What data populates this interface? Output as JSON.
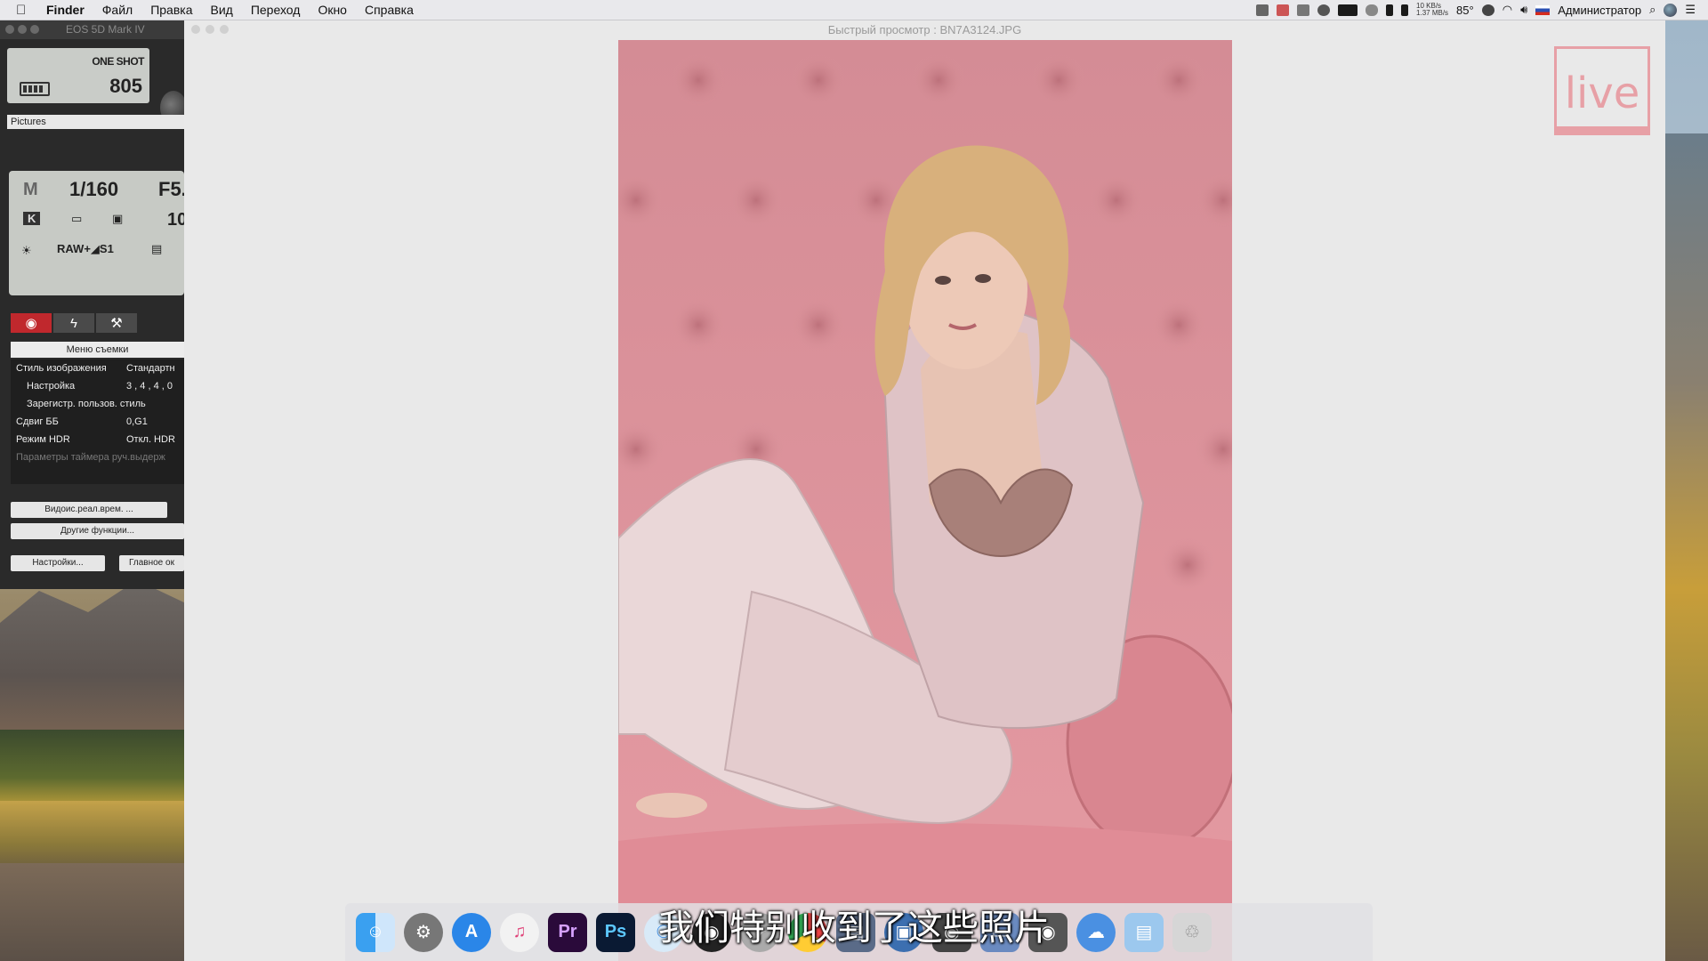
{
  "menubar": {
    "app_name": "Finder",
    "items": [
      "Файл",
      "Правка",
      "Вид",
      "Переход",
      "Окно",
      "Справка"
    ],
    "net_up": "10 KB/s",
    "net_down": "1.37 MB/s",
    "temperature": "85°",
    "user": "Администратор"
  },
  "eos": {
    "window_title": "EOS 5D Mark IV",
    "af_mode": "ONE SHOT",
    "shots_remaining": "805",
    "folder": "Pictures",
    "mode": "M",
    "shutter": "1/160",
    "aperture": "F5.",
    "iso_fragment": "10",
    "wb": "K",
    "raw_label": "RAW+◢S1",
    "menu_title": "Меню съемки",
    "menu_rows": [
      {
        "key": "Стиль изображения",
        "value": "Стандартн"
      },
      {
        "key": "Настройка",
        "value": "3 , 4 , 4 , 0"
      },
      {
        "key": "Зарегистр. пользов. стиль",
        "value": ""
      },
      {
        "key": "Сдвиг ББ",
        "value": "0,G1"
      },
      {
        "key": "Режим HDR",
        "value": "Откл. HDR"
      },
      {
        "key": "Параметры таймера руч.выдерж",
        "value": ""
      }
    ],
    "btn_live": "Видоис.реал.врем. ...",
    "btn_other": "Другие функции...",
    "btn_settings": "Настройки...",
    "btn_main": "Главное ок"
  },
  "quicklook": {
    "title": "Быстрый просмотр : BN7A3124.JPG"
  },
  "watermark": {
    "text": "live"
  },
  "subtitle": "我们特别收到了这些照片",
  "dock": {
    "icons": [
      "finder-icon",
      "system-preferences-icon",
      "app-store-icon",
      "itunes-icon",
      "premiere-icon",
      "photoshop-icon",
      "safari-icon",
      "camera-icon",
      "launchpad-icon",
      "chrome-icon",
      "folder-icon",
      "screen-icon",
      "camera-icon-2",
      "cloud-download-icon",
      "documents-folder-icon",
      "trash-icon"
    ],
    "premiere_label": "Pr",
    "photoshop_label": "Ps"
  }
}
